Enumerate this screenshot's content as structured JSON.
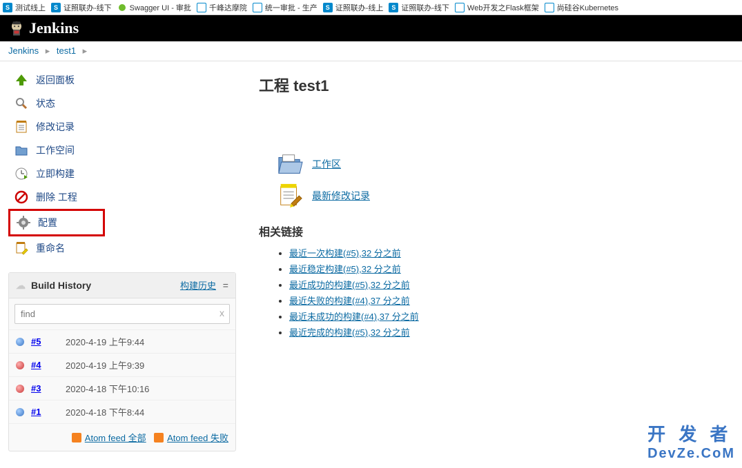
{
  "tabs": [
    {
      "icon": "ic-blue",
      "iconText": "S",
      "label": "测试线上"
    },
    {
      "icon": "ic-blue",
      "iconText": "S",
      "label": "证照联办-线下"
    },
    {
      "icon": "ic-green",
      "iconText": "",
      "label": "Swagger UI - 审批"
    },
    {
      "icon": "ic-box",
      "iconText": "",
      "label": "千峰达摩院"
    },
    {
      "icon": "ic-box",
      "iconText": "",
      "label": "统一审批 - 生产"
    },
    {
      "icon": "ic-blue",
      "iconText": "S",
      "label": "证照联办-线上"
    },
    {
      "icon": "ic-blue",
      "iconText": "S",
      "label": "证照联办-线下"
    },
    {
      "icon": "ic-box",
      "iconText": "",
      "label": "Web开发之Flask框架"
    },
    {
      "icon": "ic-box",
      "iconText": "",
      "label": "尚硅谷Kubernetes"
    }
  ],
  "header": {
    "title": "Jenkins"
  },
  "breadcrumbs": [
    {
      "label": "Jenkins"
    },
    {
      "label": "test1"
    }
  ],
  "sidebar": {
    "items": [
      {
        "label": "返回面板",
        "icon": "up-arrow"
      },
      {
        "label": "状态",
        "icon": "search"
      },
      {
        "label": "修改记录",
        "icon": "notepad"
      },
      {
        "label": "工作空间",
        "icon": "folder"
      },
      {
        "label": "立即构建",
        "icon": "clock-play"
      },
      {
        "label": "删除 工程",
        "icon": "no-entry"
      },
      {
        "label": "配置",
        "icon": "gear",
        "highlighted": true
      },
      {
        "label": "重命名",
        "icon": "notepad-pencil"
      }
    ]
  },
  "buildHistory": {
    "title": "Build History",
    "trendLabel": "构建历史",
    "searchPlaceholder": "find",
    "builds": [
      {
        "num": "#5",
        "date": "2020-4-19 上午9:44",
        "status": "blue"
      },
      {
        "num": "#4",
        "date": "2020-4-19 上午9:39",
        "status": "red"
      },
      {
        "num": "#3",
        "date": "2020-4-18 下午10:16",
        "status": "red"
      },
      {
        "num": "#1",
        "date": "2020-4-18 下午8:44",
        "status": "blue"
      }
    ],
    "feedAll": "Atom feed 全部",
    "feedFail": "Atom feed 失败"
  },
  "main": {
    "title": "工程 test1",
    "workspaceLabel": "工作区",
    "changesLabel": "最新修改记录",
    "permalinksHeading": "相关链接",
    "permalinks": [
      "最近一次构建(#5),32 分之前",
      "最近稳定构建(#5),32 分之前",
      "最近成功的构建(#5),32 分之前",
      "最近失败的构建(#4),37 分之前",
      "最近未成功的构建(#4),37 分之前",
      "最近完成的构建(#5),32 分之前"
    ]
  },
  "watermark": {
    "line1": "开 发 者",
    "line2": "DevZe.CoM"
  }
}
